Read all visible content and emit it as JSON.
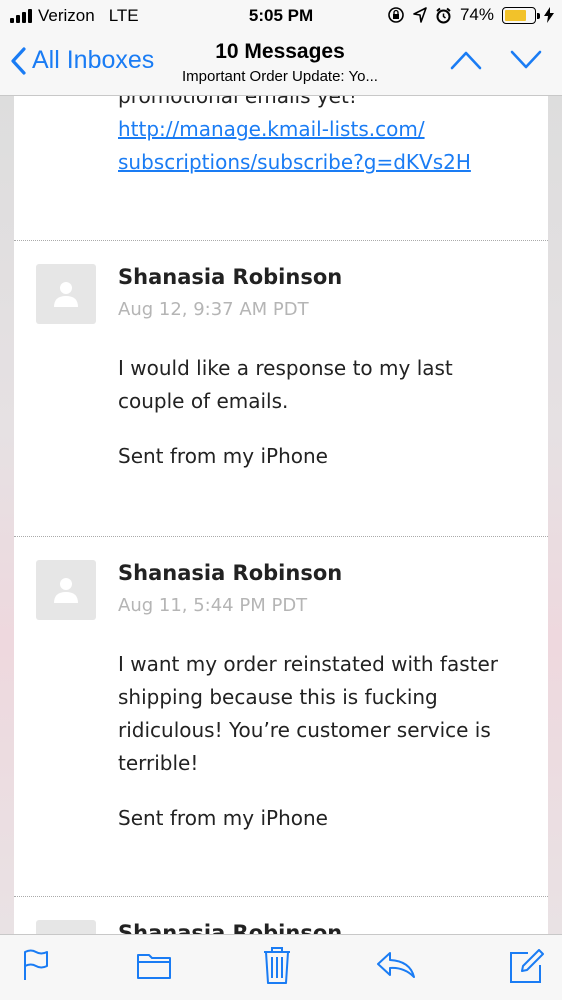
{
  "status_bar": {
    "carrier": "Verizon",
    "network": "LTE",
    "time": "5:05 PM",
    "battery_percent": "74%",
    "battery_level": 0.74
  },
  "nav": {
    "back_label": "All Inboxes",
    "title": "10 Messages",
    "subtitle": "Important Order Update: Yo..."
  },
  "previous_message": {
    "cut_text": "promotional emails yet!",
    "link_line1": "http://manage.kmail-lists.com/",
    "link_line2": "subscriptions/subscribe?g=dKVs2H"
  },
  "messages": [
    {
      "sender": "Shanasia Robinson",
      "date": "Aug 12, 9:37 AM PDT",
      "body": [
        "I would like a response to my last",
        "couple of emails."
      ],
      "signature": "Sent from my iPhone"
    },
    {
      "sender": "Shanasia Robinson",
      "date": "Aug 11, 5:44 PM PDT",
      "body": [
        "I want my order reinstated with faster",
        "shipping because this is fucking",
        "ridiculous! You’re customer service is",
        "terrible!"
      ],
      "signature": "Sent from my iPhone"
    },
    {
      "sender": "Shanasia Robinson"
    }
  ],
  "toolbar": {
    "icons": [
      "flag-icon",
      "folder-icon",
      "trash-icon",
      "reply-icon",
      "compose-icon"
    ]
  },
  "colors": {
    "accent": "#1a7cf4",
    "date_gray": "#b5b5b5",
    "battery": "#f2c22a"
  }
}
